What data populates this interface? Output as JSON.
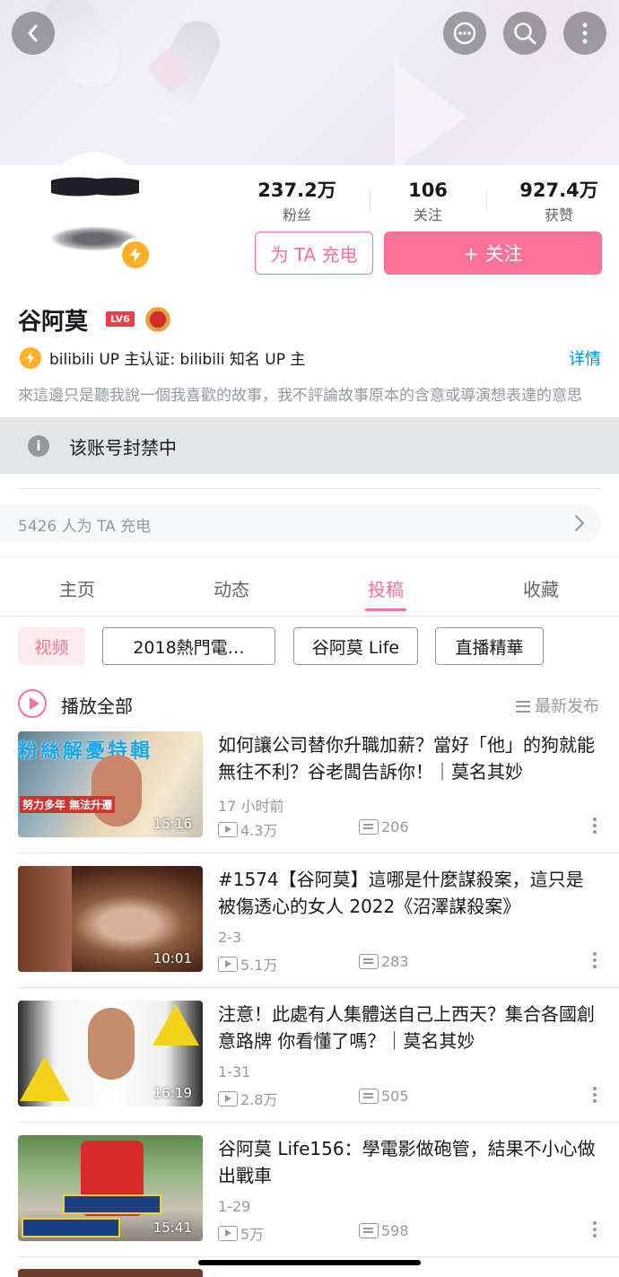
{
  "header": {
    "back_icon": "back-arrow-icon",
    "actions": [
      "message-icon",
      "search-icon",
      "more-vertical-icon"
    ]
  },
  "profile": {
    "stats": [
      {
        "value": "237.2万",
        "label": "粉丝"
      },
      {
        "value": "106",
        "label": "关注"
      },
      {
        "value": "927.4万",
        "label": "获赞"
      }
    ],
    "charge_button": "为 TA 充电",
    "follow_button": "+ 关注",
    "name": "谷阿莫",
    "level": "LV6",
    "verify_text": "bilibili UP 主认证: bilibili 知名 UP 主",
    "detail_link": "详情",
    "bio": "來這邊只是聽我說一個我喜歡的故事，我不評論故事原本的含意或導演想表達的意思"
  },
  "ban_notice": "该账号封禁中",
  "charge_count": "5426 人为 TA 充电",
  "tabs": [
    {
      "label": "主页"
    },
    {
      "label": "动态"
    },
    {
      "label": "投稿",
      "active": true
    },
    {
      "label": "收藏"
    }
  ],
  "chips": [
    "视频",
    "2018熱門電…",
    "谷阿莫 Life",
    "直播精華"
  ],
  "play_all": "播放全部",
  "sort_label": "最新发布",
  "colors": {
    "accent": "#fb7299",
    "link": "#0092d6",
    "secondary_text": "#9499a0"
  },
  "videos": [
    {
      "title": "如何讓公司替你升職加薪？當好「他」的狗就能無往不利？谷老闆告訴你！｜莫名其妙",
      "date": "17 小时前",
      "plays": "4.3万",
      "comments": "206",
      "duration": "15:16"
    },
    {
      "title": "#1574【谷阿莫】這哪是什麼謀殺案，這只是被傷透心的女人 2022《沼澤謀殺案》",
      "date": "2-3",
      "plays": "5.1万",
      "comments": "283",
      "duration": "10:01"
    },
    {
      "title": "注意！此處有人集體送自己上西天？集合各國創意路牌 你看懂了嗎？｜莫名其妙",
      "date": "1-31",
      "plays": "2.8万",
      "comments": "505",
      "duration": "16:19"
    },
    {
      "title": "谷阿莫 Life156：學電影做砲管，結果不小心做出戰車",
      "date": "1-29",
      "plays": "5万",
      "comments": "598",
      "duration": "15:41"
    }
  ]
}
